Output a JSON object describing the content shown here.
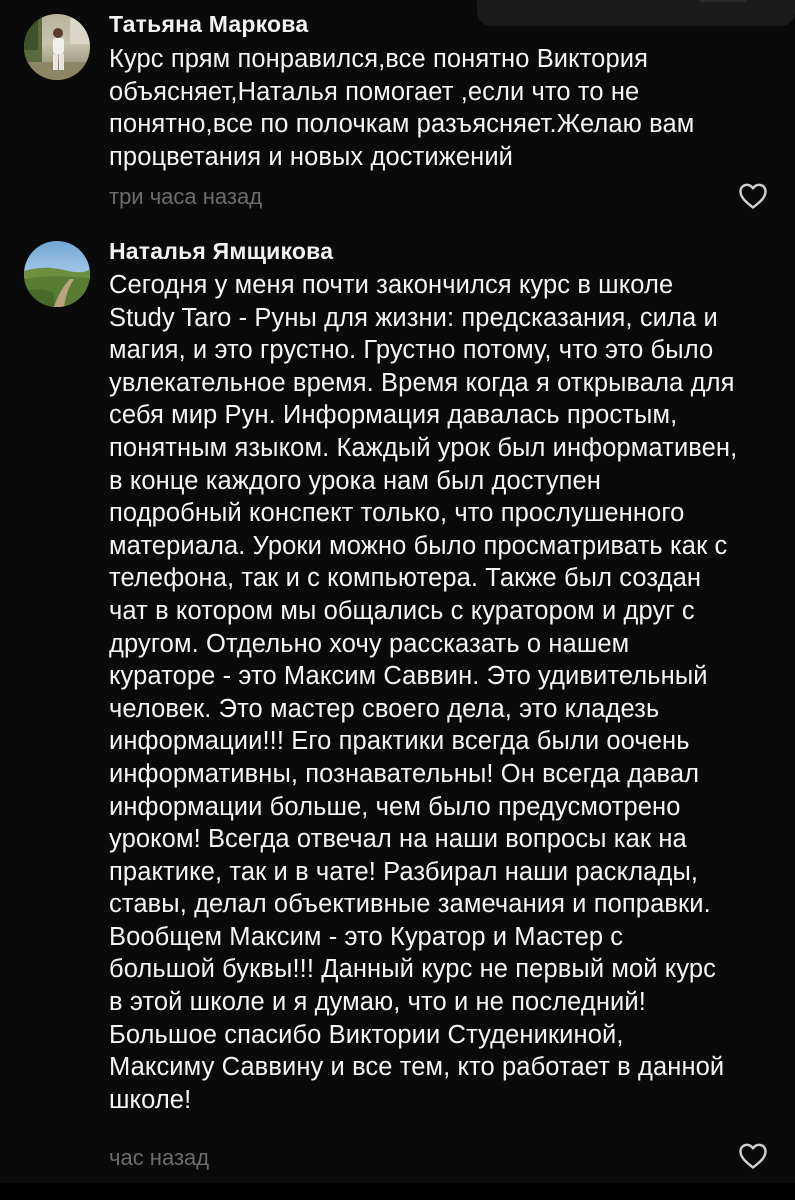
{
  "comments": [
    {
      "author": "Татьяна Маркова",
      "lines": [
        "Курс прям понравился,все понятно  Виктория",
        "объясняет,Наталья помогает ,если что то не",
        "понятно,все по полочкам разъясняет.Желаю вам",
        "процветания и новых достижений"
      ],
      "time": "три часа назад",
      "avatar_icon": "user-photo-avatar",
      "like_icon": "heart-outline-icon"
    },
    {
      "author": "Наталья Ямщикова",
      "lines": [
        "Сегодня у меня почти закончился курс в школе",
        "Study Taro - Руны для жизни: предсказания, сила и",
        "магия, и это грустно. Грустно потому, что это было",
        "увлекательное время. Время когда я открывала для",
        "себя мир Рун. Информация давалась простым,",
        "понятным языком. Каждый урок был информативен,",
        "в конце каждого урока нам был доступен",
        "подробный конспект только, что прослушенного",
        "материала. Уроки можно было просматривать как с",
        "телефона, так и с компьютера. Также был создан",
        "чат в котором мы общались с куратором и друг с",
        "другом. Отдельно хочу рассказать о нашем",
        "кураторе - это Максим Саввин. Это удивительный",
        "человек. Это мастер своего дела, это кладезь",
        "информации!!! Его практики всегда были оочень",
        "информативны, познавательны! Он всегда давал",
        "информации больше, чем было предусмотрено",
        "уроком! Всегда отвечал на наши вопросы как на",
        "практике, так и в чате! Разбирал наши расклады,",
        "ставы, делал объективные замечания и поправки.",
        "Вообщем Максим - это Куратор и Мастер с",
        "большой буквы!!! Данный курс не первый мой курс",
        "в этой школе и я думаю, что и не последний!",
        "Большое спасибо Виктории Студеникиной,",
        "Максиму Саввину и все тем, кто работает в данной",
        "школе!"
      ],
      "time": "час назад",
      "avatar_icon": "landscape-photo-avatar",
      "like_icon": "heart-outline-icon"
    }
  ],
  "colors": {
    "background": "#0a0a0a",
    "text": "#f5f5f5",
    "muted": "#6c6c6c"
  }
}
